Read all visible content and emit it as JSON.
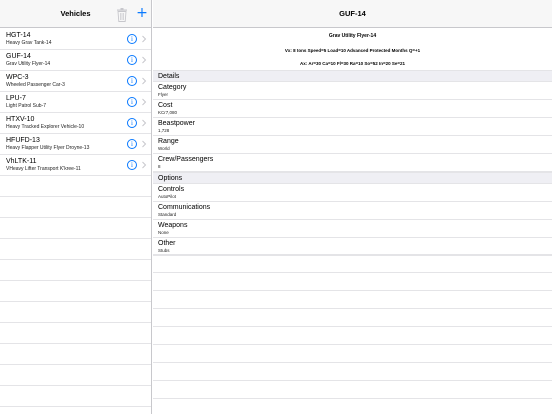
{
  "sidebar": {
    "title": "Vehicles",
    "add_label": "+",
    "items": [
      {
        "name": "HGT-14",
        "desc": "Heavy Grav Tank-14"
      },
      {
        "name": "GUF-14",
        "desc": "Grav Utility Flyer-14"
      },
      {
        "name": "WPC-3",
        "desc": "Wheeled Passenger Car-3"
      },
      {
        "name": "LPU-7",
        "desc": "Light Patrol Sub-7"
      },
      {
        "name": "HTXV-10",
        "desc": "Heavy Tracked Explorer Vehicle-10"
      },
      {
        "name": "HFUFD-13",
        "desc": "Heavy Flapper Utility Flyer Droyne-13"
      },
      {
        "name": "VhLTK-11",
        "desc": "VHeavy Lifter Transport K'kree-11"
      }
    ]
  },
  "detail": {
    "title": "GUF-14",
    "subtitle": "Grav Utility Flyer-14",
    "stats_line": "Vx: 8 tons Speed=5 Load=10 Advanced Protected Months Q=+1",
    "armor_line": "Ax: Ar=30 Ca=10 Fl=30 Ra=10 So=52 In=20 Se=21",
    "sections": [
      {
        "header": "Details",
        "fields": [
          {
            "label": "Category",
            "value": "Flyer"
          },
          {
            "label": "Cost",
            "value": "KCr7,080"
          },
          {
            "label": "Beastpower",
            "value": "1,728"
          },
          {
            "label": "Range",
            "value": "World"
          },
          {
            "label": "Crew/Passengers",
            "value": "8"
          }
        ]
      },
      {
        "header": "Options",
        "fields": [
          {
            "label": "Controls",
            "value": "AutoPilot"
          },
          {
            "label": "Communications",
            "value": "Standard"
          },
          {
            "label": "Weapons",
            "value": "None"
          },
          {
            "label": "Other",
            "value": "Stubs"
          }
        ]
      }
    ]
  },
  "colors": {
    "accent": "#0a7aff",
    "navbar": "#f7f7f7",
    "separator": "#c8c8cc",
    "section_bg": "#efeff4"
  },
  "icons": {
    "trash": "trash-icon",
    "add": "plus-icon",
    "info": "info-icon",
    "chevron": "chevron-right-icon"
  }
}
